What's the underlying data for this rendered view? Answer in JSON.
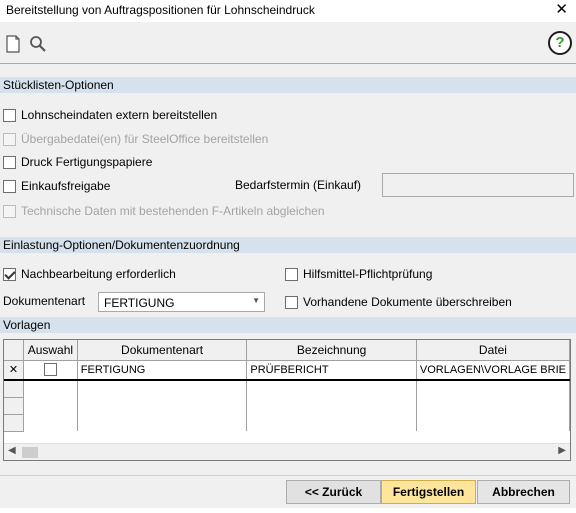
{
  "window": {
    "title": "Bereitstellung von Auftragspositionen für Lohnscheindruck",
    "close_glyph": "✕"
  },
  "toolbar": {
    "icons": [
      "new-document-icon",
      "search-icon"
    ],
    "help_glyph": "?",
    "help_color": "#2c9d2a"
  },
  "stueckliste": {
    "header": "Stücklisten-Optionen",
    "options": [
      {
        "label": "Lohnscheindaten extern bereitstellen",
        "checked": false,
        "enabled": true
      },
      {
        "label": "Übergabedatei(en) für SteelOffice bereitstellen",
        "checked": false,
        "enabled": false
      },
      {
        "label": "Druck Fertigungspapiere",
        "checked": false,
        "enabled": true
      },
      {
        "label": "Einkaufsfreigabe",
        "checked": false,
        "enabled": true
      },
      {
        "label": "Technische Daten mit bestehenden F-Artikeln abgleichen",
        "checked": false,
        "enabled": false
      }
    ],
    "bedarfstermin_label": "Bedarfstermin (Einkauf)",
    "bedarfstermin_value": ""
  },
  "einlastung": {
    "header": "Einlastung-Optionen/Dokumentenzuordnung",
    "nachbearbeitung": {
      "label": "Nachbearbeitung erforderlich",
      "checked": true
    },
    "hilfsmittel": {
      "label": "Hilfsmittel-Pflichtprüfung",
      "checked": false
    },
    "dokumentenart_label": "Dokumentenart",
    "dokumentenart_value": "FERTIGUNG",
    "ueberschreiben": {
      "label": "Vorhandene Dokumente überschreiben",
      "checked": false
    }
  },
  "vorlagen": {
    "header": "Vorlagen",
    "columns": [
      "Auswahl",
      "Dokumentenart",
      "Bezeichnung",
      "Datei"
    ],
    "rows": [
      {
        "marker": "✕",
        "auswahl": false,
        "dokumentenart": "FERTIGUNG",
        "bezeichnung": "PRÜFBERICHT",
        "datei": "VORLAGEN\\VORLAGE BRIE"
      }
    ]
  },
  "buttons": {
    "back": "<< Zurück",
    "finish": "Fertigstellen",
    "cancel": "Abbrechen"
  },
  "colors": {
    "section_header": "#d6e1ee",
    "primary_button": "#fde69c"
  }
}
